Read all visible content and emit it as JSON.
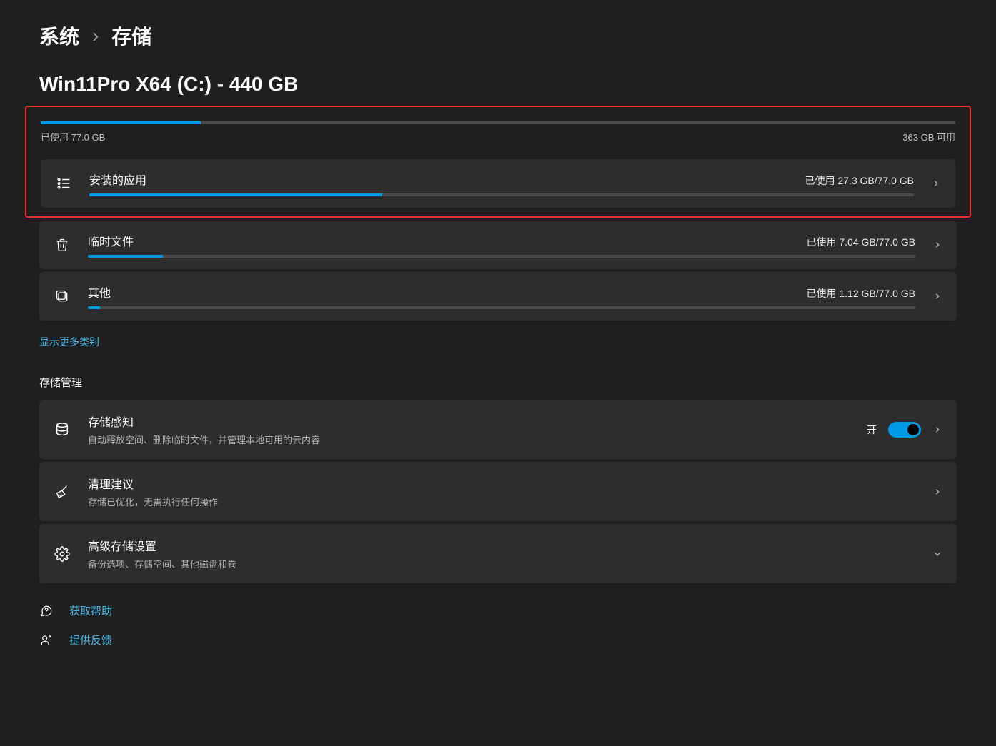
{
  "breadcrumb": {
    "parent": "系统",
    "current": "存储"
  },
  "drive": {
    "title": "Win11Pro X64 (C:) - 440 GB",
    "used_label": "已使用 77.0 GB",
    "free_label": "363 GB 可用",
    "used_pct": 17.5
  },
  "categories": [
    {
      "title": "安装的应用",
      "usage": "已使用 27.3 GB/77.0 GB",
      "pct": 35.5,
      "icon": "apps"
    },
    {
      "title": "临时文件",
      "usage": "已使用 7.04 GB/77.0 GB",
      "pct": 9.1,
      "icon": "trash"
    },
    {
      "title": "其他",
      "usage": "已使用 1.12 GB/77.0 GB",
      "pct": 1.5,
      "icon": "other"
    }
  ],
  "more_link": "显示更多类别",
  "section_title": "存储管理",
  "management": [
    {
      "title": "存储感知",
      "desc": "自动释放空间、删除临时文件，并管理本地可用的云内容",
      "icon": "db",
      "toggle": {
        "label": "开",
        "on": true
      },
      "chev": "right"
    },
    {
      "title": "清理建议",
      "desc": "存储已优化，无需执行任何操作",
      "icon": "broom",
      "chev": "right"
    },
    {
      "title": "高级存储设置",
      "desc": "备份选项、存储空间、其他磁盘和卷",
      "icon": "gear",
      "chev": "down"
    }
  ],
  "help": [
    {
      "label": "获取帮助",
      "icon": "help"
    },
    {
      "label": "提供反馈",
      "icon": "feedback"
    }
  ]
}
